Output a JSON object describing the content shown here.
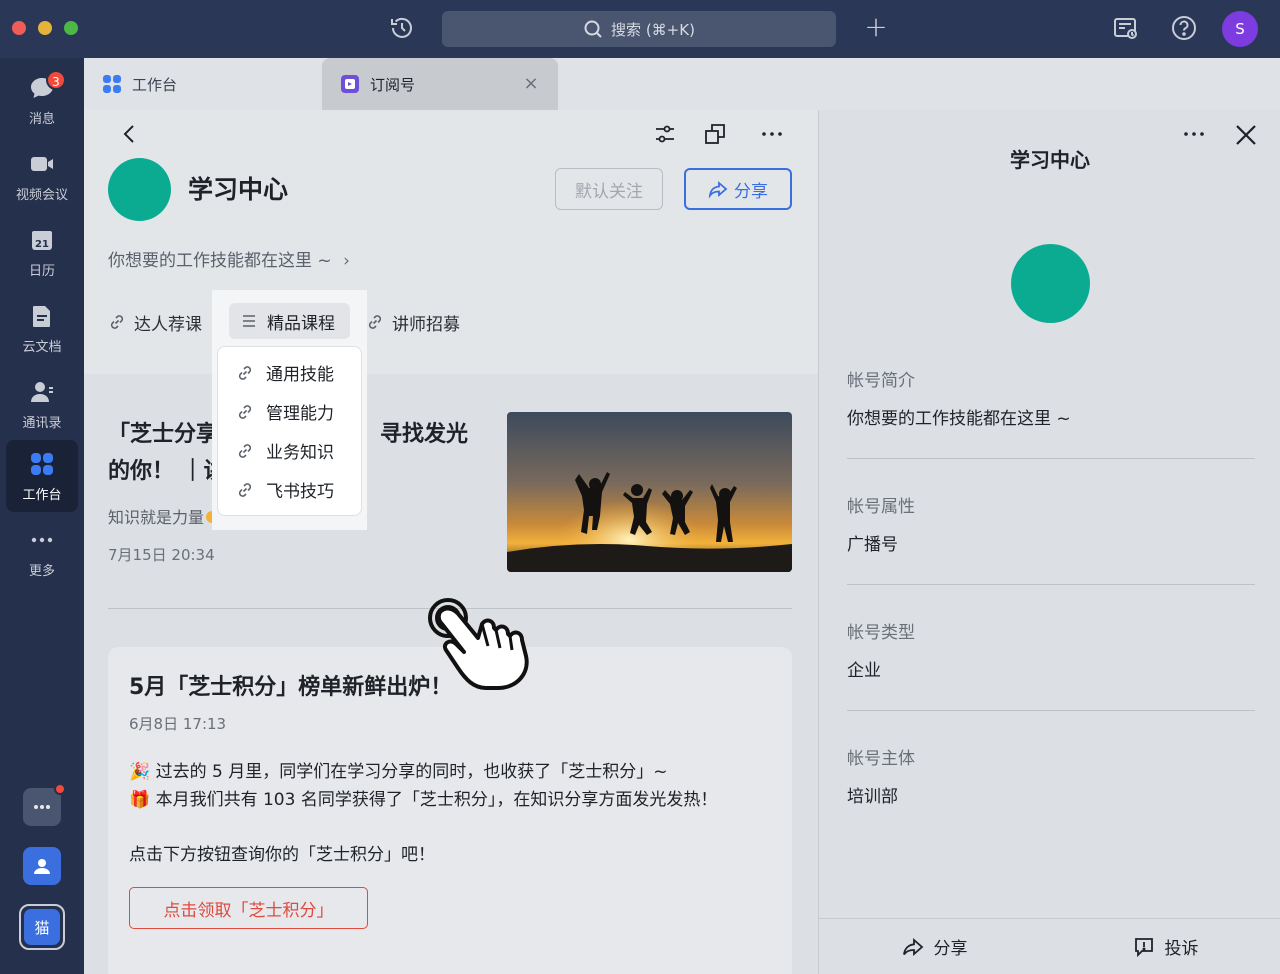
{
  "topbar": {
    "search_label": "搜索 (⌘+K)",
    "plus": "+",
    "avatar_initial": "S"
  },
  "nav": {
    "messages": {
      "label": "消息",
      "badge": "3"
    },
    "video": {
      "label": "视频会议"
    },
    "calendar": {
      "label": "日历",
      "day": "21"
    },
    "docs": {
      "label": "云文档"
    },
    "contacts": {
      "label": "通讯录"
    },
    "workplace": {
      "label": "工作台"
    },
    "more": {
      "label": "更多"
    },
    "bottom_app": {
      "label": "猫"
    }
  },
  "tabs": [
    {
      "label": "工作台"
    },
    {
      "label": "订阅号"
    }
  ],
  "account": {
    "title": "学习中心",
    "follow_label": "默认关注",
    "share_label": "分享",
    "description": "你想要的工作技能都在这里 ~"
  },
  "menu": {
    "item1": "达人荐课",
    "item2": "精品课程",
    "item3": "讲师招募",
    "dropdown": [
      "通用技能",
      "管理能力",
      "业务知识",
      "飞书技巧"
    ]
  },
  "article1": {
    "title_line1": "「芝士分享",
    "title_line1_tail": "，寻找发光",
    "title_line2": "的你！ ｜讲",
    "subtitle": "知识就是力量",
    "date": "7月15日 20:34"
  },
  "article2": {
    "title": "5月「芝士积分」榜单新鲜出炉！",
    "date": "6月8日 17:13",
    "line1": "🎉 过去的 5 月里，同学们在学习分享的同时，也收获了「芝士积分」~",
    "line2": "🎁 本月我们共有 103 名同学获得了「芝士积分」，在知识分享方面发光发热！",
    "line3": "点击下方按钮查询你的「芝士积分」吧！",
    "button": "点击领取「芝士积分」"
  },
  "rpanel": {
    "title": "学习中心",
    "intro_label": "帐号简介",
    "intro_value": "你想要的工作技能都在这里 ~",
    "attr_label": "帐号属性",
    "attr_value": "广播号",
    "type_label": "帐号类型",
    "type_value": "企业",
    "owner_label": "帐号主体",
    "owner_value": "培训部",
    "share_label": "分享",
    "report_label": "投诉"
  },
  "colors": {
    "accent": "#3b6fe0",
    "avatar": "#0bab92",
    "danger": "#e04a3f",
    "user_avatar": "#7d3ce0"
  }
}
